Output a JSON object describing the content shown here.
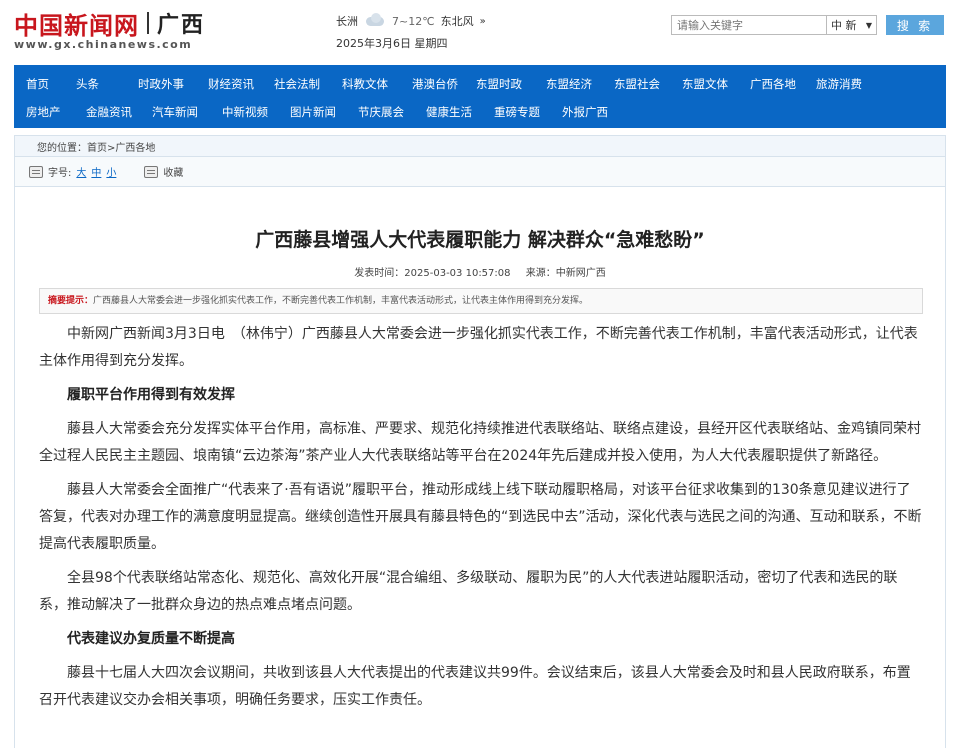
{
  "header": {
    "logo_text": "中国新闻网",
    "logo_region": "广西",
    "logo_url": "www.gx.chinanews.com"
  },
  "weather": {
    "city": "长洲",
    "temp": "7~12℃",
    "wind": "东北风",
    "more": "»",
    "date": "2025年3月6日 星期四"
  },
  "search": {
    "placeholder": "请输入关键字",
    "scope": "中 新",
    "button": "搜 索"
  },
  "nav": {
    "row1": [
      "首页",
      "头条",
      "时政外事",
      "财经资讯",
      "社会法制",
      "科教文体",
      "港澳台侨",
      "东盟时政",
      "东盟经济",
      "东盟社会",
      "东盟文体",
      "广西各地",
      "旅游消费"
    ],
    "row2": [
      "房地产",
      "金融资讯",
      "汽车新闻",
      "中新视频",
      "图片新闻",
      "节庆展会",
      "健康生活",
      "重磅专题",
      "外报广西"
    ]
  },
  "breadcrumb": "您的位置：首页>广西各地",
  "tools": {
    "font_label": "字号:",
    "sizes": [
      "大",
      "中",
      "小"
    ],
    "favorite": "收藏"
  },
  "article": {
    "title": "广西藤县增强人大代表履职能力 解决群众“急难愁盼”",
    "publish_time": "发表时间：2025-03-03 10:57:08",
    "source": "来源：中新网广西",
    "summary_label": "摘要提示：",
    "summary_text": "广西藤县人大常委会进一步强化抓实代表工作，不断完善代表工作机制，丰富代表活动形式，让代表主体作用得到充分发挥。",
    "p1": "中新网广西新闻3月3日电　（林伟宁）广西藤县人大常委会进一步强化抓实代表工作，不断完善代表工作机制，丰富代表活动形式，让代表主体作用得到充分发挥。",
    "h1": "履职平台作用得到有效发挥",
    "p2": "藤县人大常委会充分发挥实体平台作用，高标准、严要求、规范化持续推进代表联络站、联络点建设，县经开区代表联络站、金鸡镇同荣村全过程人民民主主题园、埌南镇“云边茶海”茶产业人大代表联络站等平台在2024年先后建成并投入使用，为人大代表履职提供了新路径。",
    "p3": "藤县人大常委会全面推广“代表来了·吾有语说”履职平台，推动形成线上线下联动履职格局，对该平台征求收集到的130条意见建议进行了答复，代表对办理工作的满意度明显提高。继续创造性开展具有藤县特色的“到选民中去”活动，深化代表与选民之间的沟通、互动和联系，不断提高代表履职质量。",
    "p4": "全县98个代表联络站常态化、规范化、高效化开展“混合编组、多级联动、履职为民”的人大代表进站履职活动，密切了代表和选民的联系，推动解决了一批群众身边的热点难点堵点问题。",
    "h2": "代表建议办复质量不断提高",
    "p5": "藤县十七届人大四次会议期间，共收到该县人大代表提出的代表建议共99件。会议结束后，该县人大常委会及时和县人民政府联系，布置召开代表建议交办会相关事项，明确任务要求，压实工作责任。"
  }
}
